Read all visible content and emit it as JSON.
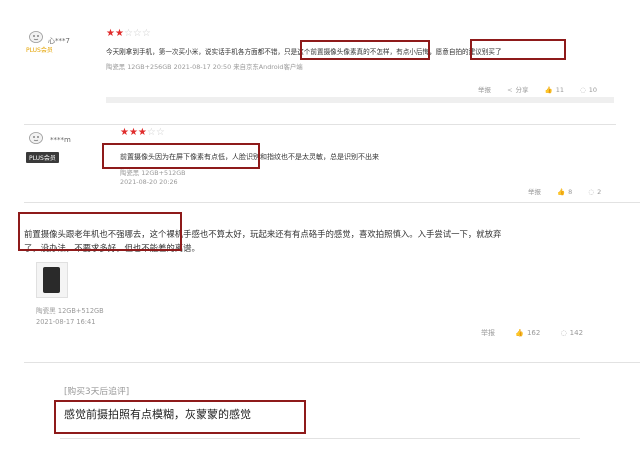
{
  "review1": {
    "user": "心***7",
    "level": "PLUS会员",
    "stars_on": "★★",
    "stars_off": "☆☆☆",
    "text": "今天刚拿到手机，第一次买小米，说实话手机各方面都不错，只是这个前置摄像头像素真的不怎样，有点小后悔，愿意自拍的建议别买了",
    "meta": "陶瓷黑    12GB+256GB    2021-08-17  20:50      来自京东Android客户端",
    "report": "举报",
    "share": "分享",
    "likes": "11",
    "comments": "10"
  },
  "review2": {
    "user": "****m",
    "level": "PLUS会员",
    "stars_on": "★★★",
    "stars_off": "☆☆",
    "text": "前置摄像头因为在屏下像素有点低，人脸识别和指纹也不是太灵敏，总是识别不出来",
    "meta1": "陶瓷黑        12GB+512GB",
    "meta2": "2021-08-20 20:26",
    "report": "举报",
    "likes": "8",
    "comments": "2"
  },
  "review3": {
    "text1": "前置摄像头跟老年机也不强哪去，这个裸机手感也不算太好，玩起来还有有点硌手的感觉，喜欢拍照慎入。入手尝试一下，就放弃",
    "text2": "了，没办法，不要求多好，但也不能差的离谱。",
    "meta": "陶瓷黑    12GB+512GB",
    "date": "2021-08-17 16:41",
    "report": "举报",
    "likes": "162",
    "comments": "142"
  },
  "followup": {
    "label": "[购买3天后追评]",
    "text": "感觉前摄拍照有点模糊，灰蒙蒙的感觉"
  },
  "colors": {
    "highlight_box": "#8e1a1a",
    "star": "#e02c2c",
    "plus_gold": "#e4a300"
  },
  "icons": {
    "avatar": "avatar-icon",
    "share": "share-icon",
    "like": "thumbs-up-icon",
    "comment": "comment-icon"
  }
}
